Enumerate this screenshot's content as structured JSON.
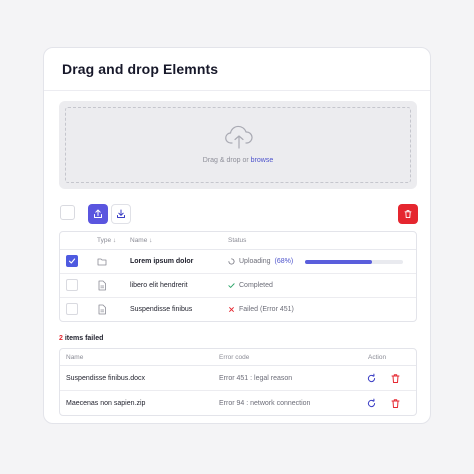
{
  "card": {
    "title": "Drag and drop Elemnts"
  },
  "dropzone": {
    "text": "Drag & drop or ",
    "browse": "browse"
  },
  "toolbar": {
    "upload_icon": "upload-icon",
    "download_icon": "download-icon",
    "delete_icon": "trash-icon"
  },
  "files": {
    "columns": {
      "type": "Type ↓",
      "name": "Name ↓",
      "status": "Status"
    },
    "rows": [
      {
        "checked": true,
        "icon": "folder-icon",
        "name": "Lorem ipsum dolor",
        "status_text": "Uploading",
        "status_pct": "(68%)",
        "progress": 68
      },
      {
        "checked": false,
        "icon": "document-icon",
        "name": "libero elit hendrerit",
        "status_text": "Completed"
      },
      {
        "checked": false,
        "icon": "document-icon",
        "name": "Suspendisse finibus",
        "status_text": "Failed (Error 451)"
      }
    ]
  },
  "failed": {
    "count": "2",
    "label": " items failed"
  },
  "errors": {
    "columns": {
      "name": "Name",
      "code": "Error code",
      "action": "Action"
    },
    "rows": [
      {
        "name": "Suspendisse finibus.docx",
        "code": "Error 451 : legal reason"
      },
      {
        "name": "Maecenas non sapien.zip",
        "code": "Error 94 : network connection"
      }
    ]
  },
  "colors": {
    "accent": "#5a55df",
    "danger": "#e5262f",
    "success": "#2fa66a"
  }
}
